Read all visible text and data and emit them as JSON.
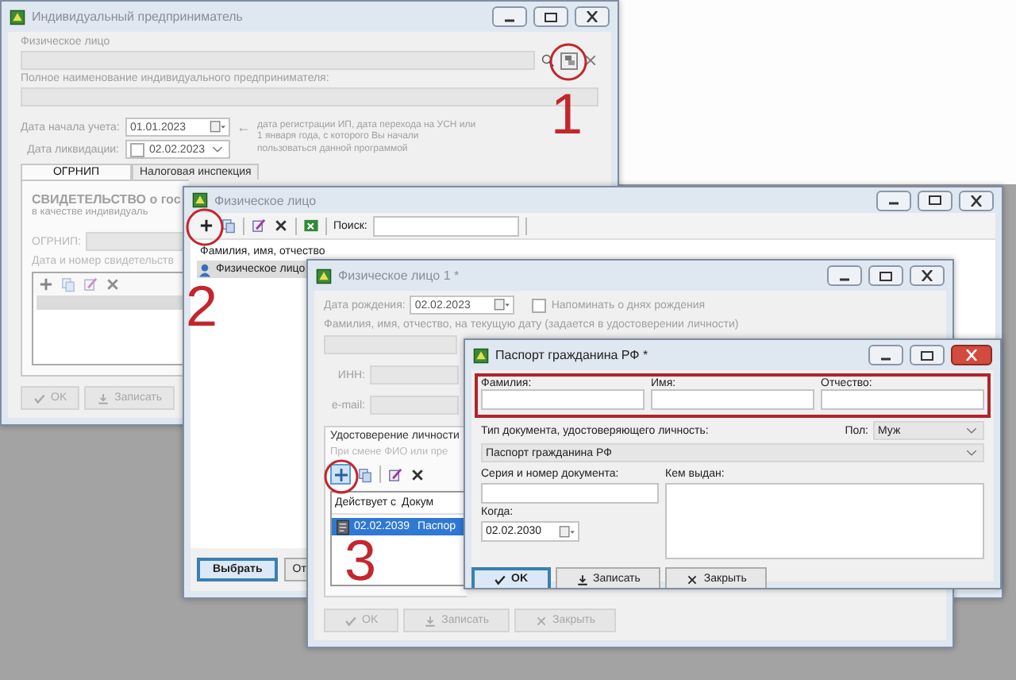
{
  "entrepreneur_window": {
    "title": "Индивидуальный предприниматель",
    "person_label": "Физическое лицо",
    "full_name_label": "Полное наименование индивидуального предпринимателя:",
    "start_date": {
      "label": "Дата начала учета:",
      "value": "01.01.2023"
    },
    "start_hint": {
      "arrow": "←",
      "text": "дата регистрации ИП, дата перехода на УСН или 1 января года, с которого Вы начали пользоваться данной программой"
    },
    "liquidation": {
      "label": "Дата ликвидации:",
      "checked": false,
      "value": "02.02.2023"
    },
    "tabs": [
      {
        "label": "ОГРНИП",
        "selected": true
      },
      {
        "label": "Налоговая инспекция",
        "selected": false
      }
    ],
    "certificate_heading": "СВИДЕТЕЛЬСТВО о гос",
    "certificate_subheading": "в качестве индивидуаль",
    "ogrnip_label": "ОГРНИП:",
    "certificate_list_label": "Дата и номер свидетельств",
    "buttons": [
      {
        "label": "OK",
        "kind": "ok",
        "disabled": true
      },
      {
        "label": "Записать",
        "kind": "save",
        "disabled": true
      }
    ]
  },
  "persons_window": {
    "title": "Физическое лицо",
    "search_label": "Поиск:",
    "column": "Фамилия, имя, отчество",
    "rows": [
      {
        "name": "Физическое лицо",
        "selected": true
      }
    ],
    "buttons": [
      {
        "label": "Выбрать",
        "default": true
      },
      {
        "label": "От",
        "default": false
      }
    ]
  },
  "person_window": {
    "title": "Физическое лицо 1 *",
    "birth_date": {
      "label": "Дата рождения:",
      "value": "02.02.2023"
    },
    "remind": {
      "label": "Напоминать о днях рождения",
      "checked": false
    },
    "name_label": "Фамилия, имя, отчество, на текущую дату (задается в удостоверении личности)",
    "inn_label": "ИНН:",
    "email_label": "e-mail:",
    "id_tab": "Удостоверение личности",
    "id_hint": "При смене ФИО или пре",
    "columns": [
      "Действует с",
      "Докум"
    ],
    "rows": [
      {
        "cells": [
          "02.02.2039",
          "Паспор"
        ],
        "selected": true
      }
    ],
    "buttons": [
      {
        "label": "OK",
        "kind": "ok",
        "disabled": true
      },
      {
        "label": "Записать",
        "kind": "save",
        "disabled": true
      },
      {
        "label": "Закрыть",
        "kind": "close",
        "disabled": true
      }
    ]
  },
  "passport_window": {
    "title": "Паспорт гражданина РФ *",
    "name_fields": [
      {
        "label": "Фамилия:"
      },
      {
        "label": "Имя:"
      },
      {
        "label": "Отчество:"
      }
    ],
    "doc_type_label": "Тип документа, удостоверяющего личность:",
    "gender": {
      "label": "Пол:",
      "value": "Муж"
    },
    "doc_type_value": "Паспорт гражданина РФ",
    "series_label": "Серия и номер документа:",
    "issued_by_label": "Кем выдан:",
    "date": {
      "label": "Когда:",
      "value": "02.02.2030"
    },
    "buttons": [
      {
        "label": "OK",
        "kind": "ok",
        "default": true
      },
      {
        "label": "Записать",
        "kind": "save",
        "default": false
      },
      {
        "label": "Закрыть",
        "kind": "close",
        "default": false
      }
    ]
  },
  "annotations": [
    {
      "number": "1"
    },
    {
      "number": "2"
    },
    {
      "number": "3"
    }
  ]
}
